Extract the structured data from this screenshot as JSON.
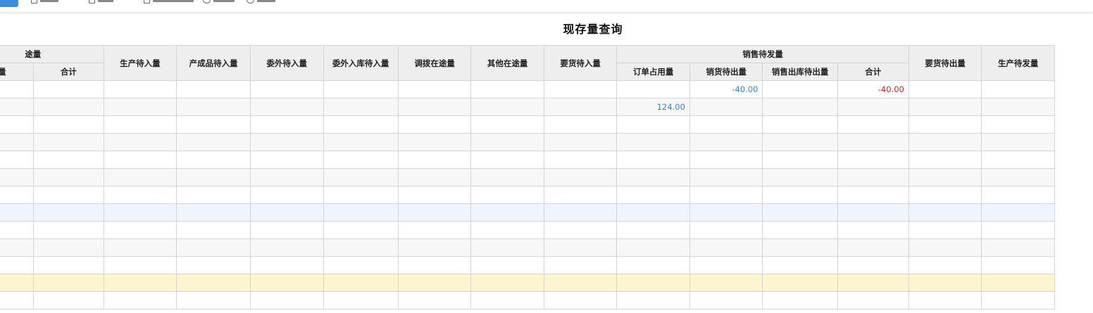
{
  "title": "现存量查询",
  "toolbar": {
    "items": [
      {
        "icon": "document-icon"
      },
      {
        "icon": "document-icon"
      },
      {
        "icon": "save-icon"
      },
      {
        "icon": "refresh-icon"
      },
      {
        "icon": "clock-icon"
      }
    ]
  },
  "colors": {
    "accent": "#3c8dde",
    "positive": "#3b7fd9",
    "negative": "#e02020",
    "selected_row": "#eef5fd",
    "highlight_row": "#fdf5cf"
  },
  "table": {
    "group_headers": {
      "in_transit": "途量",
      "sales_pending": "销售待发量"
    },
    "headers": {
      "in_qty": "入量",
      "in_total": "合计",
      "prod_pending_in": "生产待入量",
      "finished_pending_in": "产成品待入量",
      "outsource_pending_in": "委外待入量",
      "outsource_warehouse_pending_in": "委外入库待入量",
      "transfer_in_transit": "调拨在途量",
      "other_in_transit": "其他在途量",
      "requisition_pending_in": "要货待入量",
      "order_occupied": "订单占用量",
      "sales_pending_out": "销货待出量",
      "sales_warehouse_pending_out": "销售出库待出量",
      "sales_total": "合计",
      "requisition_pending_out": "要货待出量",
      "prod_pending_out": "生产待发量"
    },
    "rows": [
      {
        "sales_pending_out": "-40.00",
        "sales_total": "-40.00"
      },
      {
        "order_occupied": "124.00"
      },
      {},
      {},
      {},
      {},
      {},
      {},
      {},
      {},
      {},
      {},
      {}
    ],
    "selected_row": 7,
    "highlight_row": 11
  }
}
